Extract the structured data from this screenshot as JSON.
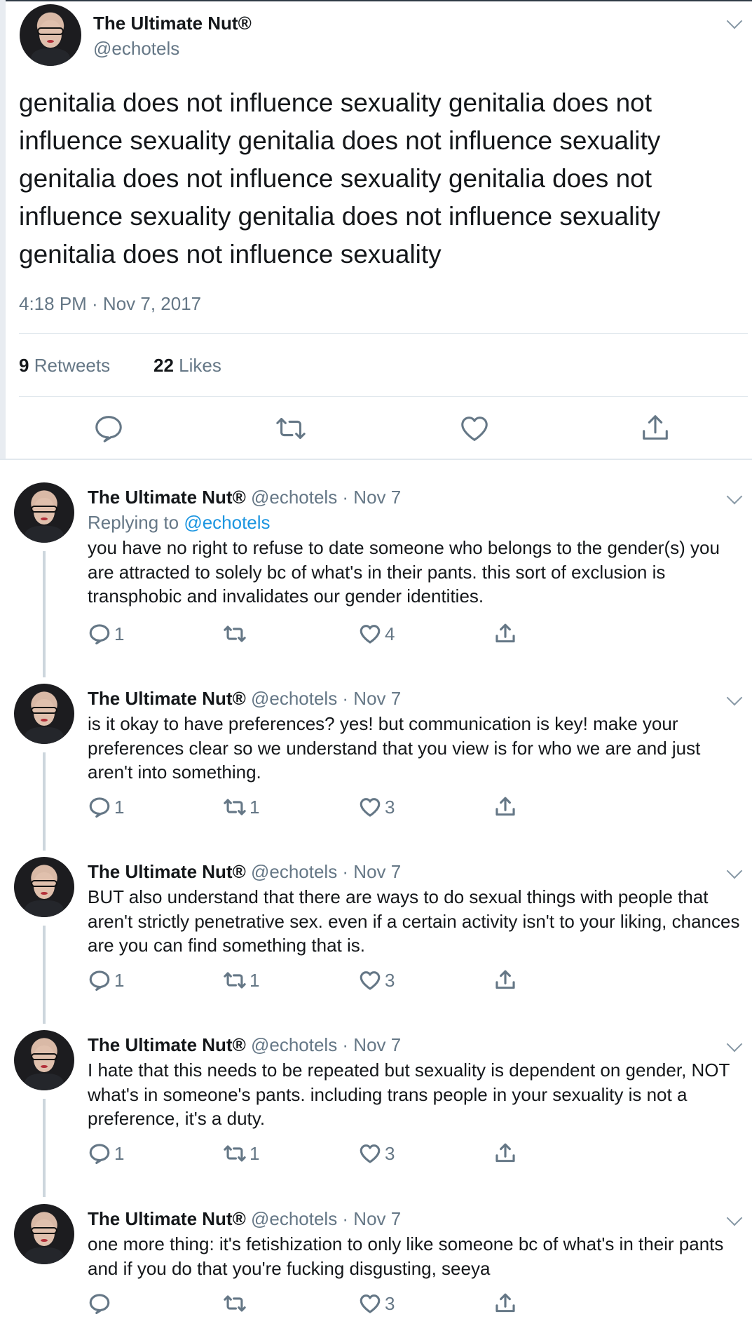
{
  "main_tweet": {
    "display_name": "The Ultimate Nut®",
    "handle": "@echotels",
    "text": "genitalia does not influence sexuality genitalia does not influence sexuality genitalia does not influence sexuality genitalia does not influence sexuality genitalia does not influence sexuality genitalia does not influence sexuality genitalia does not influence sexuality",
    "timestamp": "4:18 PM · Nov 7, 2017",
    "retweets_count": "9",
    "retweets_label": "Retweets",
    "likes_count": "22",
    "likes_label": "Likes",
    "actions": [
      "reply-icon",
      "retweet-icon",
      "like-icon",
      "share-icon"
    ]
  },
  "replies": [
    {
      "display_name": "The Ultimate Nut®",
      "meta": "@echotels · Nov 7",
      "replying_prefix": "Replying to",
      "replying_to": "@echotels",
      "text": "you have no right to refuse to date someone who belongs to the gender(s) you are attracted to solely bc of what's in their pants. this sort of exclusion is transphobic and invalidates our gender identities.",
      "reply_count": "1",
      "retweet_count": "",
      "like_count": "4"
    },
    {
      "display_name": "The Ultimate Nut®",
      "meta": "@echotels · Nov 7",
      "text": "is it okay to have preferences? yes! but communication is key! make your preferences clear so we understand that you view is for who we are and just aren't into something.",
      "reply_count": "1",
      "retweet_count": "1",
      "like_count": "3"
    },
    {
      "display_name": "The Ultimate Nut®",
      "meta": "@echotels · Nov 7",
      "text": "BUT also understand that there are ways to do sexual things with people that aren't strictly penetrative sex. even if a certain activity isn't to your liking, chances are you can find something that is.",
      "reply_count": "1",
      "retweet_count": "1",
      "like_count": "3"
    },
    {
      "display_name": "The Ultimate Nut®",
      "meta": "@echotels · Nov 7",
      "text": "I hate that this needs to be repeated but sexuality is dependent on gender, NOT what's in someone's pants. including trans people in your sexuality is not a preference, it's a duty.",
      "reply_count": "1",
      "retweet_count": "1",
      "like_count": "3"
    },
    {
      "display_name": "The Ultimate Nut®",
      "meta": "@echotels · Nov 7",
      "text": "one more thing: it's fetishization to only like someone bc of what's in their pants and if you do that you're fucking disgusting, seeya",
      "reply_count": "",
      "retweet_count": "",
      "like_count": "3"
    }
  ]
}
